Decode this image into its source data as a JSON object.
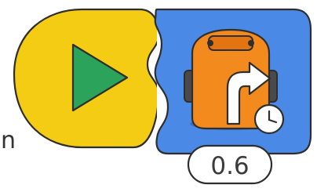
{
  "blocks": [
    {
      "id": "start-block",
      "kind": "start",
      "icon": "green-flag-play-icon",
      "color": "#f5cc14",
      "icon_color": "#2ca35a"
    },
    {
      "id": "turn-right-block",
      "kind": "motion",
      "icon": "robot-turn-right-icon",
      "badge_icon": "timer-clock-icon",
      "color": "#4a8ae6",
      "robot_color": "#f28a1e",
      "parameter": "0.6"
    }
  ],
  "cut_label": "en"
}
